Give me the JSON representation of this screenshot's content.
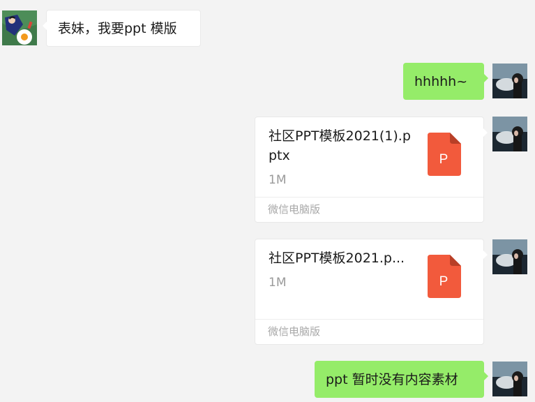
{
  "messages": [
    {
      "sender": "cousin",
      "type": "text",
      "text": "表妹，我要ppt 模版"
    },
    {
      "sender": "me",
      "type": "text",
      "text": "hhhhh~"
    },
    {
      "sender": "me",
      "type": "file",
      "file_name": "社区PPT模板2021(1).pptx",
      "file_size": "1M",
      "icon_letter": "P",
      "source": "微信电脑版"
    },
    {
      "sender": "me",
      "type": "file",
      "file_name": "社区PPT模板2021.p...",
      "file_size": "1M",
      "icon_letter": "P",
      "source": "微信电脑版"
    },
    {
      "sender": "me",
      "type": "text",
      "text": "ppt 暂时没有内容素材"
    }
  ],
  "colors": {
    "background": "#f3f3f3",
    "incoming_bubble": "#ffffff",
    "outgoing_bubble": "#95ec69",
    "ppt_icon": "#f25a3c"
  }
}
